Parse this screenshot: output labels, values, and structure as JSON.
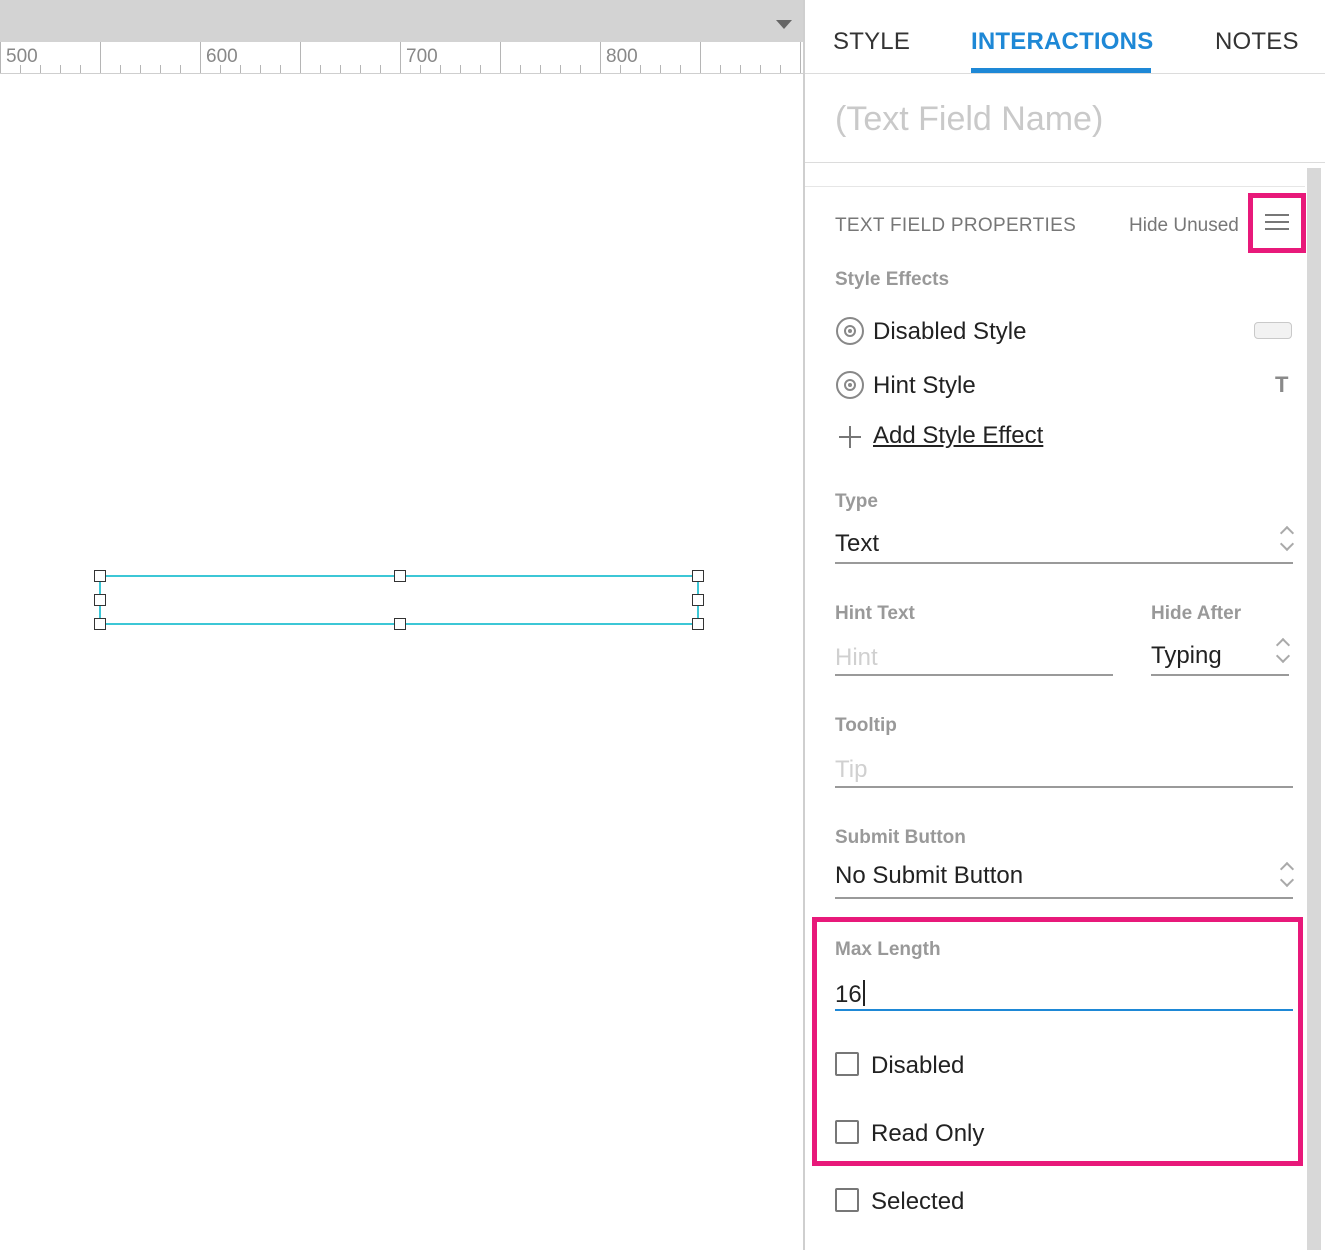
{
  "ruler": {
    "labels": [
      "500",
      "600",
      "700",
      "800"
    ]
  },
  "tabs": {
    "style": "STYLE",
    "interactions": "INTERACTIONS",
    "notes": "NOTES",
    "active": "interactions"
  },
  "widget_name_placeholder": "(Text Field Name)",
  "properties": {
    "section_title": "TEXT FIELD PROPERTIES",
    "hide_unused": "Hide Unused",
    "style_effects": {
      "label": "Style Effects",
      "items": [
        "Disabled Style",
        "Hint Style"
      ],
      "hint_style_glyph": "T",
      "add_label": "Add Style Effect"
    },
    "type": {
      "label": "Type",
      "value": "Text"
    },
    "hint_text": {
      "label": "Hint Text",
      "placeholder": "Hint"
    },
    "hide_after": {
      "label": "Hide After",
      "value": "Typing"
    },
    "tooltip": {
      "label": "Tooltip",
      "placeholder": "Tip"
    },
    "submit_button": {
      "label": "Submit Button",
      "value": "No Submit Button"
    },
    "max_length": {
      "label": "Max Length",
      "value": "16"
    },
    "checkboxes": {
      "disabled": {
        "label": "Disabled",
        "checked": false
      },
      "read_only": {
        "label": "Read Only",
        "checked": false
      },
      "selected": {
        "label": "Selected",
        "checked": false
      }
    }
  },
  "colors": {
    "accent_blue": "#1e88d6",
    "highlight_pink": "#e8197a",
    "selection_cyan": "#3cc7d6"
  },
  "icons": [
    "dropdown-arrow-icon",
    "menu-lines-icon",
    "style-effect-icon",
    "plus-icon",
    "text-glyph-icon",
    "up-down-arrows-icon"
  ]
}
